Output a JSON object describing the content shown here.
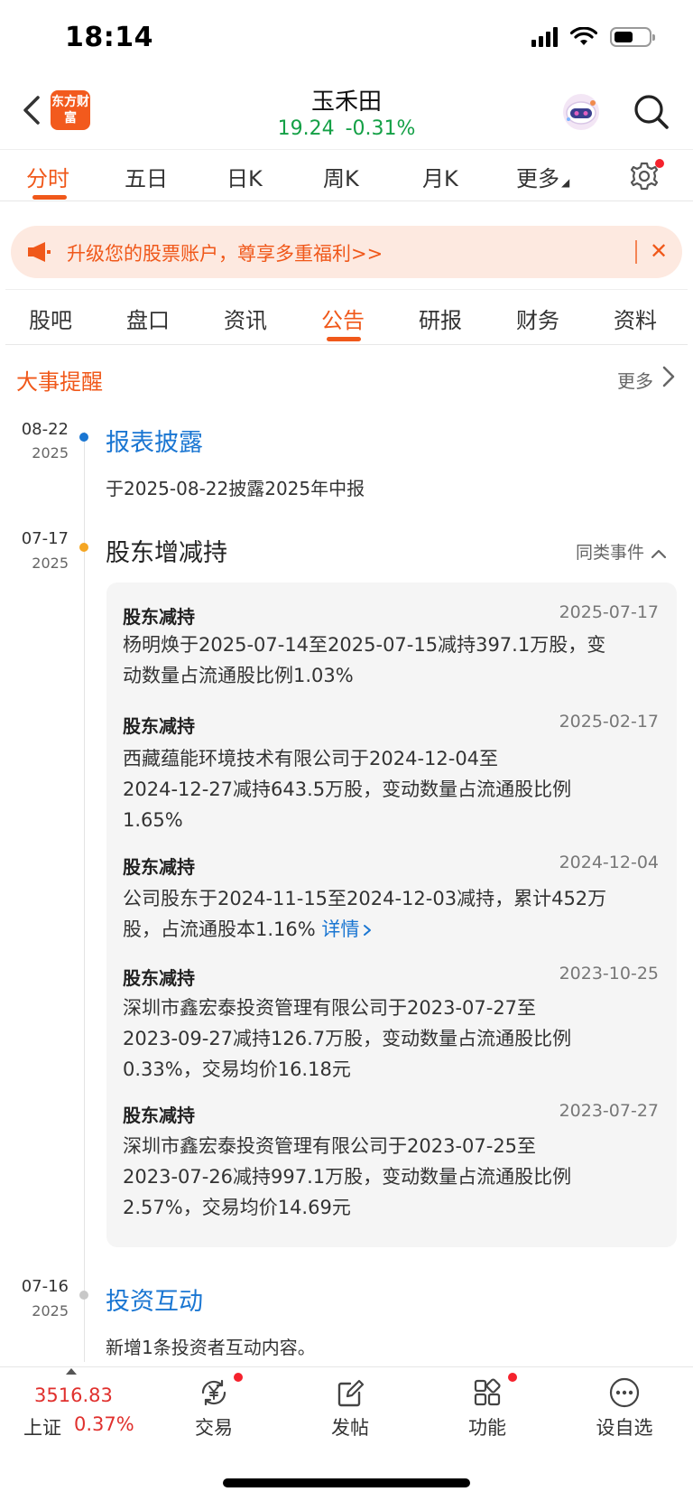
{
  "status": {
    "time": "18:14"
  },
  "header": {
    "logo_text": "东方财富",
    "stock_name": "玉禾田",
    "price": "19.24",
    "change_pct": "-0.31%"
  },
  "chart_tabs": [
    "分时",
    "五日",
    "日K",
    "周K",
    "月K",
    "更多"
  ],
  "promo": {
    "text": "升级您的股票账户，尊享多重福利>>",
    "close": "✕"
  },
  "news_tabs": [
    "股吧",
    "盘口",
    "资讯",
    "公告",
    "研报",
    "财务",
    "资料"
  ],
  "section": {
    "title": "大事提醒",
    "more": "更多"
  },
  "timeline": [
    {
      "date": "08-22",
      "year": "2025",
      "title": "报表披露",
      "desc": "于2025-08-22披露2025年中报"
    },
    {
      "date": "07-17",
      "year": "2025",
      "title": "股东增减持",
      "similar": "同类事件"
    },
    {
      "date": "07-16",
      "year": "2025",
      "title": "投资互动",
      "desc": "新增1条投资者互动内容。"
    }
  ],
  "events": [
    {
      "type": "股东减持",
      "date": "2025-07-17",
      "line1": "杨明焕于2025-07-14至2025-07-15减持397.1万股，变",
      "line2": "动数量占流通股比例1.03%"
    },
    {
      "type": "股东减持",
      "date": "2025-02-17",
      "line1": "西藏蕴能环境技术有限公司于2024-12-04至",
      "line2": "2024-12-27减持643.5万股，变动数量占流通股比例",
      "line3": "1.65%"
    },
    {
      "type": "股东减持",
      "date": "2024-12-04",
      "line1": "公司股东于2024-11-15至2024-12-03减持，累计452万",
      "line2": "股，占流通股本1.16%",
      "detail": "详情"
    },
    {
      "type": "股东减持",
      "date": "2023-10-25",
      "line1": "深圳市鑫宏泰投资管理有限公司于2023-07-27至",
      "line2": "2023-09-27减持126.7万股，变动数量占流通股比例",
      "line3": "0.33%，交易均价16.18元"
    },
    {
      "type": "股东减持",
      "date": "2023-07-27",
      "line1": "深圳市鑫宏泰投资管理有限公司于2023-07-25至",
      "line2": "2023-07-26减持997.1万股，变动数量占流通股比例",
      "line3": "2.57%，交易均价14.69元"
    }
  ],
  "bottom": {
    "index_value": "3516.83",
    "index_name": "上证",
    "index_change": "0.37%",
    "nav": [
      "交易",
      "发帖",
      "功能",
      "设自选"
    ]
  },
  "colors": {
    "accent": "#f0581a",
    "link_blue": "#1a76d2",
    "quote_green": "#14a046",
    "index_red": "#e0302d"
  }
}
